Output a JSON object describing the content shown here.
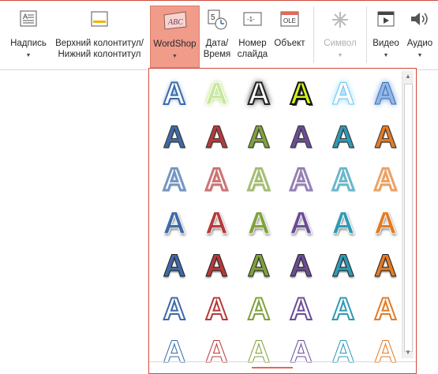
{
  "ribbon": {
    "buttons": [
      {
        "id": "textbox",
        "label": "Надпись",
        "icon": "textbox-icon",
        "has_arrow": true
      },
      {
        "id": "header",
        "label": "Верхний колонтитул/\nНижний колонтитул",
        "icon": "header-footer-icon",
        "has_arrow": true
      },
      {
        "id": "wordart",
        "label": "WordShop",
        "icon": "wordart-icon",
        "icon_text": "ABC",
        "has_arrow": true,
        "active": true
      },
      {
        "id": "datetime",
        "label": "Дата/\nВремя",
        "icon": "calendar-clock-icon",
        "icon_text": "5"
      },
      {
        "id": "slidenum",
        "label": "Номер\nслайда",
        "icon": "slide-number-icon",
        "icon_text": "-1-"
      },
      {
        "id": "object",
        "label": "Объект",
        "icon": "object-icon",
        "icon_text": "OLE"
      },
      {
        "id": "symbol",
        "label": "Символ",
        "icon": "symbol-icon",
        "has_arrow": true,
        "disabled": true
      },
      {
        "id": "video",
        "label": "Видео",
        "icon": "video-icon",
        "has_arrow": true
      },
      {
        "id": "audio",
        "label": "Аудио",
        "icon": "audio-icon",
        "has_arrow": true
      }
    ]
  },
  "gallery": {
    "glyph": "A",
    "rows": 7,
    "cols": 6,
    "palette": [
      "#3d6aa8",
      "#b73a3a",
      "#7fa23b",
      "#6b4d96",
      "#2f9ab5",
      "#e57b23"
    ],
    "accent": "#d04a3a"
  }
}
